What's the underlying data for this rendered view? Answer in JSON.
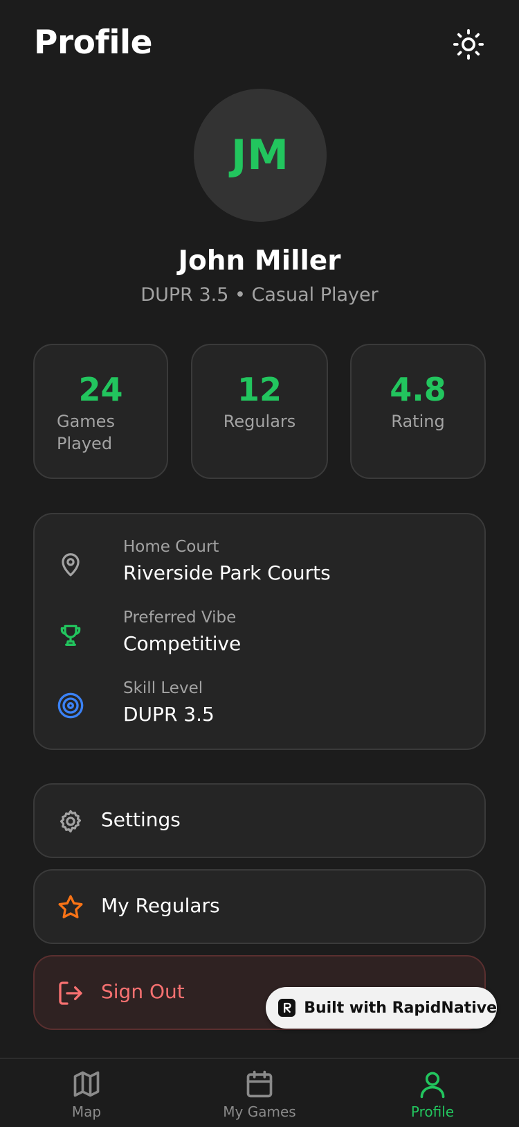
{
  "header": {
    "title": "Profile",
    "theme_toggle_icon": "sun-icon"
  },
  "profile": {
    "initials": "JM",
    "name": "John Miller",
    "subtitle": "DUPR 3.5 • Casual Player"
  },
  "stats": [
    {
      "value": "24",
      "label": "Games Played"
    },
    {
      "value": "12",
      "label": "Regulars"
    },
    {
      "value": "4.8",
      "label": "Rating"
    }
  ],
  "details": [
    {
      "icon": "map-pin-icon",
      "label": "Home Court",
      "value": "Riverside Park Courts"
    },
    {
      "icon": "trophy-icon",
      "label": "Preferred Vibe",
      "value": "Competitive"
    },
    {
      "icon": "target-icon",
      "label": "Skill Level",
      "value": "DUPR 3.5"
    }
  ],
  "menu": {
    "settings": {
      "icon": "gear-icon",
      "label": "Settings"
    },
    "regulars": {
      "icon": "star-icon",
      "label": "My Regulars"
    },
    "signout": {
      "icon": "log-out-icon",
      "label": "Sign Out"
    }
  },
  "badge": {
    "text": "Built with RapidNative"
  },
  "tabs": [
    {
      "icon": "map-icon",
      "label": "Map",
      "active": false
    },
    {
      "icon": "calendar-icon",
      "label": "My Games",
      "active": false
    },
    {
      "icon": "user-icon",
      "label": "Profile",
      "active": true
    }
  ],
  "colors": {
    "background": "#1c1c1c",
    "card": "#252525",
    "accent": "#22c55e",
    "muted": "#a3a3a3",
    "danger": "#f87171",
    "star": "#f97316",
    "target": "#3b82f6"
  }
}
